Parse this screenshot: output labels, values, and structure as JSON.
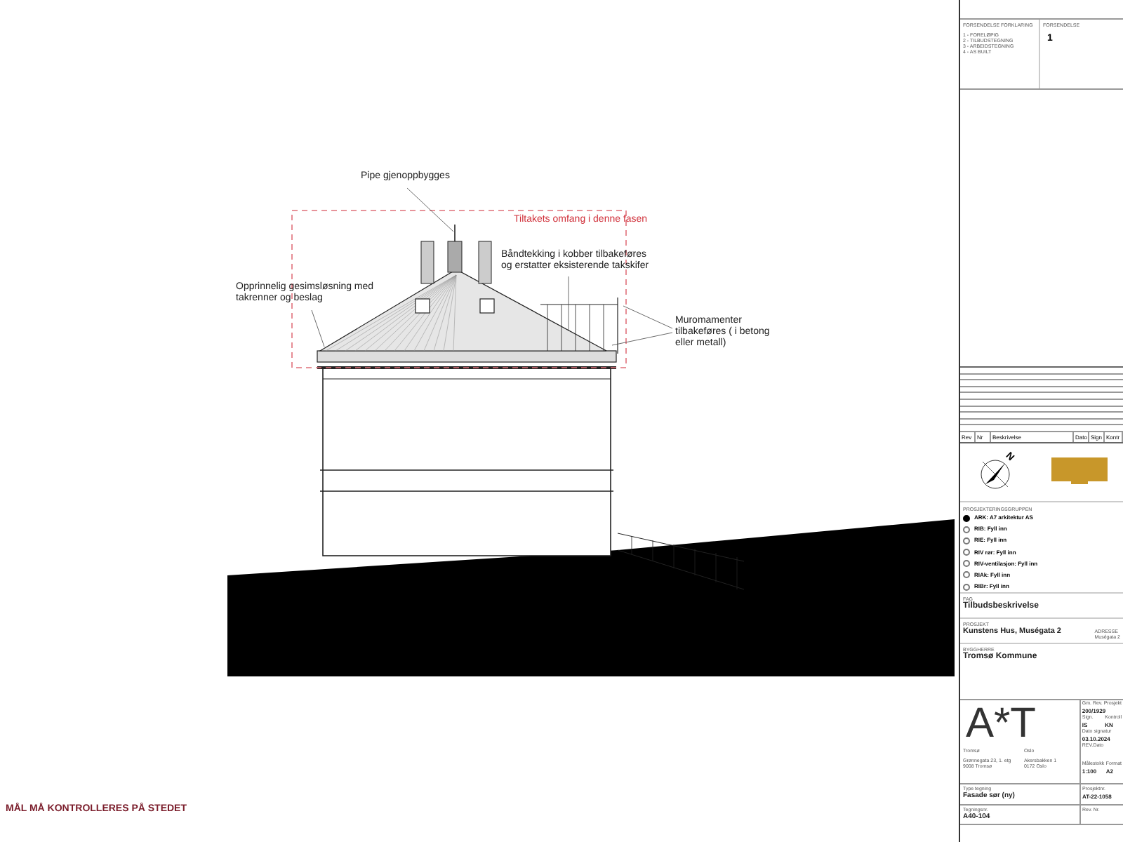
{
  "drawing": {
    "annotations": [
      {
        "kind": "plain",
        "text": "Pipe gjenoppbygges"
      },
      {
        "kind": "scope",
        "text": "Tiltakets omfang i denne fasen"
      },
      {
        "kind": "plain",
        "text": "Båndtekking i kobber tilbakeføres\nog erstatter eksisterende takskifer"
      },
      {
        "kind": "plain",
        "text": "Opprinnelig gesimsløsning med\ntakrenner og beslag"
      },
      {
        "kind": "plain",
        "text": "Muromamenter\ntilbakeføres ( i betong\neller metall)"
      }
    ],
    "warning": "MÅL MÅ KONTROLLERES PÅ STEDET"
  },
  "title_block": {
    "revision_status": {
      "legend_title": "FORSENDELSE FORKLARING",
      "legend": [
        "1 - FORELØPIG",
        "2 - TILBUDSTEGNING",
        "3 - ARBEIDSTEGNING",
        "4 - AS BUILT"
      ],
      "value_title": "FORSENDELSE",
      "value": "1"
    },
    "revision_table": {
      "columns": [
        "Rev",
        "Nr",
        "Beskrivelse",
        "Dato",
        "Sign",
        "Kontr"
      ]
    },
    "north_arrow": {
      "letter": "N"
    },
    "design_team": {
      "title": "PROSJEKTERINGSGRUPPEN",
      "members": [
        {
          "label": "ARK: A7 arkitektur AS",
          "selected": true
        },
        {
          "label": "RIB: Fyll inn",
          "selected": false
        },
        {
          "label": "RIE: Fyll inn",
          "selected": false
        },
        {
          "label": "RIV rør: Fyll inn",
          "selected": false
        },
        {
          "label": "RIV-ventilasjon: Fyll inn",
          "selected": false
        },
        {
          "label": "RIAk: Fyll inn",
          "selected": false
        },
        {
          "label": "RIBr: Fyll inn",
          "selected": false
        }
      ]
    },
    "discipline": {
      "label": "FAG",
      "value": "Tilbudsbeskrivelse"
    },
    "project": {
      "label": "PROSJEKT",
      "value": "Kunstens Hus, Muségata 2",
      "address_label": "ADRESSE",
      "address": "Muségata 2"
    },
    "client": {
      "label": "BYGGHERRE",
      "value": "Tromsø Kommune"
    },
    "firm": {
      "logo": "A*T",
      "offices": [
        {
          "city": "Tromsø",
          "address": "Grønnegata 23, 1. etg\n9008 Tromsø"
        },
        {
          "city": "Oslo",
          "address": "Akersbakken 1\n0172 Oslo"
        }
      ]
    },
    "fields": [
      {
        "label": "Gm. Rev. Prosjekt",
        "value": "200/1929"
      },
      {
        "label": "Sign.",
        "value": "IS"
      },
      {
        "label": "Kontroll",
        "value": "KN"
      },
      {
        "label": "Dato signatur",
        "value": "03.10.2024"
      },
      {
        "label": "REV.Dato"
      },
      {
        "label": "Målestokk",
        "value": "1:100"
      },
      {
        "label": "Format",
        "value": "A2"
      }
    ],
    "drawing_type": {
      "label": "Type tegning",
      "value": "Fasade sør (ny)"
    },
    "project_number": {
      "label": "Prosjektnr.",
      "value": "AT-22-1058"
    },
    "drawing_number": {
      "label": "Tegningsnr.",
      "value": "A40-104"
    },
    "revision_number": {
      "label": "Rev. Nr."
    }
  }
}
